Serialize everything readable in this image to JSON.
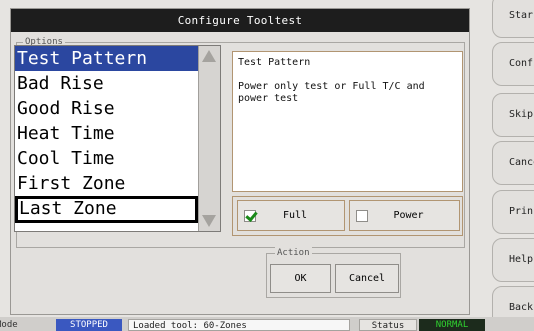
{
  "dialog": {
    "title": "Configure Tooltest",
    "options_legend": "Options",
    "list_items": [
      "Test Pattern",
      "Bad Rise",
      "Good Rise",
      "Heat Time",
      "Cool Time",
      "First Zone",
      "Last Zone"
    ],
    "description_title": "Test Pattern",
    "description_body": "Power only test or Full T/C and power test",
    "full_label": "Full",
    "power_label": "Power",
    "action_legend": "Action",
    "ok_label": "OK",
    "cancel_label": "Cancel"
  },
  "side_buttons": [
    "Star",
    "Confi",
    "Skip",
    "Cance",
    "Prin",
    "Help",
    "Back"
  ],
  "statusbar": {
    "mode_label": "Mode",
    "mode_value": "STOPPED",
    "message": "Loaded tool: 60-Zones",
    "status_label": "Status",
    "status_value": "NORMAL"
  },
  "colors": {
    "selected": "#2b47a0",
    "stopped_bg": "#3a58c0",
    "normal_bg": "#1c2b1c",
    "normal_fg": "#2fd12f"
  }
}
